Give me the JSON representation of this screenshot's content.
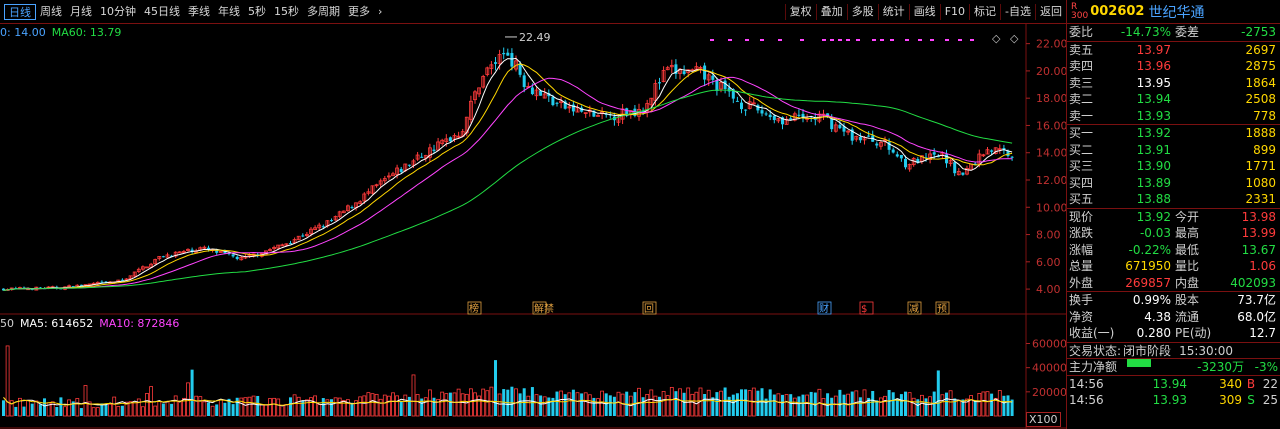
{
  "toolbar": {
    "periods": [
      "日线",
      "周线",
      "月线",
      "10分钟",
      "45日线",
      "季线",
      "年线",
      "5秒",
      "15秒",
      "多周期",
      "更多"
    ],
    "active_period": "日线",
    "more_arrow": "›",
    "tools": [
      "复权",
      "叠加",
      "多股",
      "统计",
      "画线",
      "F10",
      "标记",
      "-自选",
      "返回"
    ]
  },
  "ma_legend": {
    "ma30": "0: 14.00",
    "ma60": "MA60: 13.79"
  },
  "vol_legend": {
    "vol": "50",
    "ma5": "MA5: 614652",
    "ma10": "MA10: 872846"
  },
  "price_axis": [
    "22.00",
    "20.00",
    "18.00",
    "16.00",
    "14.00",
    "12.00",
    "10.00",
    "8.00",
    "6.00",
    "4.00"
  ],
  "vol_axis": [
    "60000",
    "40000",
    "20000"
  ],
  "x100_label": "X100",
  "peak_label": "22.49",
  "event_markers": [
    {
      "label": "榜",
      "color": "#e0a040"
    },
    {
      "label": "解禁",
      "color": "#e0a040"
    },
    {
      "label": "回",
      "color": "#e0a040"
    },
    {
      "label": "财",
      "color": "#4aa3ff"
    },
    {
      "label": "$",
      "color": "#ff3b3b"
    },
    {
      "label": "减",
      "color": "#e0a040"
    },
    {
      "label": "预",
      "color": "#e0a040"
    }
  ],
  "stock": {
    "badge_top": "R",
    "badge_bottom": "300",
    "code": "002602",
    "name": "世纪华通"
  },
  "weibi": {
    "label": "委比",
    "value": "-14.73%",
    "label2": "委差",
    "value2": "-2753"
  },
  "asks": [
    {
      "label": "卖五",
      "price": "13.97",
      "vol": "2697",
      "cls": "red"
    },
    {
      "label": "卖四",
      "price": "13.96",
      "vol": "2875",
      "cls": "red"
    },
    {
      "label": "卖三",
      "price": "13.95",
      "vol": "1864",
      "cls": "white"
    },
    {
      "label": "卖二",
      "price": "13.94",
      "vol": "2508",
      "cls": "green"
    },
    {
      "label": "卖一",
      "price": "13.93",
      "vol": "778",
      "cls": "green"
    }
  ],
  "bids": [
    {
      "label": "买一",
      "price": "13.92",
      "vol": "1888",
      "cls": "green"
    },
    {
      "label": "买二",
      "price": "13.91",
      "vol": "899",
      "cls": "green"
    },
    {
      "label": "买三",
      "price": "13.90",
      "vol": "1771",
      "cls": "green"
    },
    {
      "label": "买四",
      "price": "13.89",
      "vol": "1080",
      "cls": "green"
    },
    {
      "label": "买五",
      "price": "13.88",
      "vol": "2331",
      "cls": "green"
    }
  ],
  "quote": [
    {
      "k": "现价",
      "v": "13.92",
      "vc": "green",
      "k2": "今开",
      "v2": "13.98",
      "v2c": "red"
    },
    {
      "k": "涨跌",
      "v": "-0.03",
      "vc": "green",
      "k2": "最高",
      "v2": "13.99",
      "v2c": "red"
    },
    {
      "k": "涨幅",
      "v": "-0.22%",
      "vc": "green",
      "k2": "最低",
      "v2": "13.67",
      "v2c": "green"
    },
    {
      "k": "总量",
      "v": "671950",
      "vc": "yellow",
      "k2": "量比",
      "v2": "1.06",
      "v2c": "red"
    },
    {
      "k": "外盘",
      "v": "269857",
      "vc": "red",
      "k2": "内盘",
      "v2": "402093",
      "v2c": "green"
    }
  ],
  "fund": [
    {
      "k": "换手",
      "v": "0.99%",
      "vc": "white",
      "k2": "股本",
      "v2": "73.7亿",
      "v2c": "white"
    },
    {
      "k": "净资",
      "v": "4.38",
      "vc": "white",
      "k2": "流通",
      "v2": "68.0亿",
      "v2c": "white"
    },
    {
      "k": "收益(一)",
      "v": "0.280",
      "vc": "white",
      "k2": "PE(动)",
      "v2": "12.7",
      "v2c": "white"
    }
  ],
  "status": {
    "label": "交易状态:",
    "value": "闭市阶段",
    "time": "15:30:00"
  },
  "main_fund": {
    "label": "主力净额",
    "value": "-3230万",
    "pct": "-3%"
  },
  "ticks": [
    {
      "t": "14:56",
      "p": "13.94",
      "vol": "340",
      "bs": "B",
      "n": "22"
    },
    {
      "t": "14:56",
      "p": "13.93",
      "vol": "309",
      "bs": "S",
      "n": "25"
    }
  ],
  "colors": {
    "up": "#ff3b3b",
    "down": "#22dd44",
    "ma5": "#ffffff",
    "ma10": "#ffd700",
    "ma20": "#ff44ff",
    "ma60": "#22dd44",
    "grid": "#7a1010"
  }
}
